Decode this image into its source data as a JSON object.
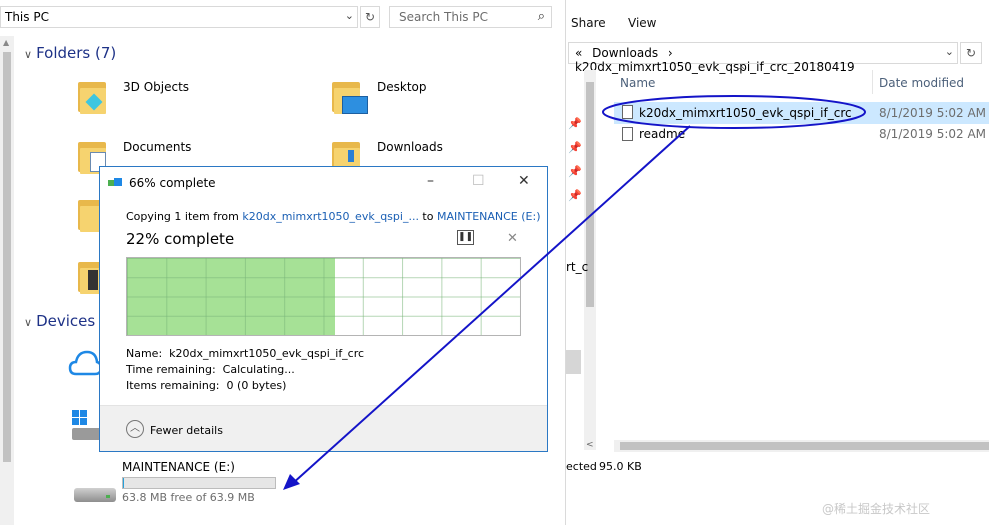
{
  "left_window": {
    "address": "This PC",
    "search_placeholder": "Search This PC",
    "folders_header": "Folders (7)",
    "folders": [
      "3D Objects",
      "Desktop",
      "Documents",
      "Downloads"
    ],
    "devices_header": "Devices a",
    "drive_label": "MAINTENANCE (E:)",
    "drive_free": "63.8 MB free of 63.9 MB",
    "drive_used_fraction": 0.002
  },
  "right_window": {
    "tabs": [
      "Share",
      "View"
    ],
    "breadcrumb_chev": "«",
    "breadcrumb_1": "Downloads",
    "breadcrumb_sep": "›",
    "breadcrumb_2": "k20dx_mimxrt1050_evk_qspi_if_crc_20180419",
    "col_name": "Name",
    "col_date": "Date modified",
    "files": [
      {
        "name": "k20dx_mimxrt1050_evk_qspi_if_crc",
        "date": "8/1/2019 5:02 AM"
      },
      {
        "name": "readme",
        "date": "8/1/2019 5:02 AM"
      }
    ],
    "partial_text": "rt_c",
    "status_selected": "ected",
    "status_size": "95.0 KB"
  },
  "dialog": {
    "title": "66% complete",
    "copying_prefix": "Copying 1 item from ",
    "copying_source": "k20dx_mimxrt1050_evk_qspi_...",
    "copying_to": " to ",
    "copying_dest": "MAINTENANCE (E:)",
    "percent_text": "22% complete",
    "progress_fraction": 0.53,
    "name_label": "Name:",
    "name_value": "k20dx_mimxrt1050_evk_qspi_if_crc",
    "time_label": "Time remaining:",
    "time_value": "Calculating...",
    "items_label": "Items remaining:",
    "items_value": "0 (0 bytes)",
    "fewer_details": "Fewer details"
  },
  "watermark": "@稀土掘金技术社区",
  "colors": {
    "accent": "#1a5fb4",
    "annotation": "#1414c8",
    "progress": "#a6e196"
  }
}
